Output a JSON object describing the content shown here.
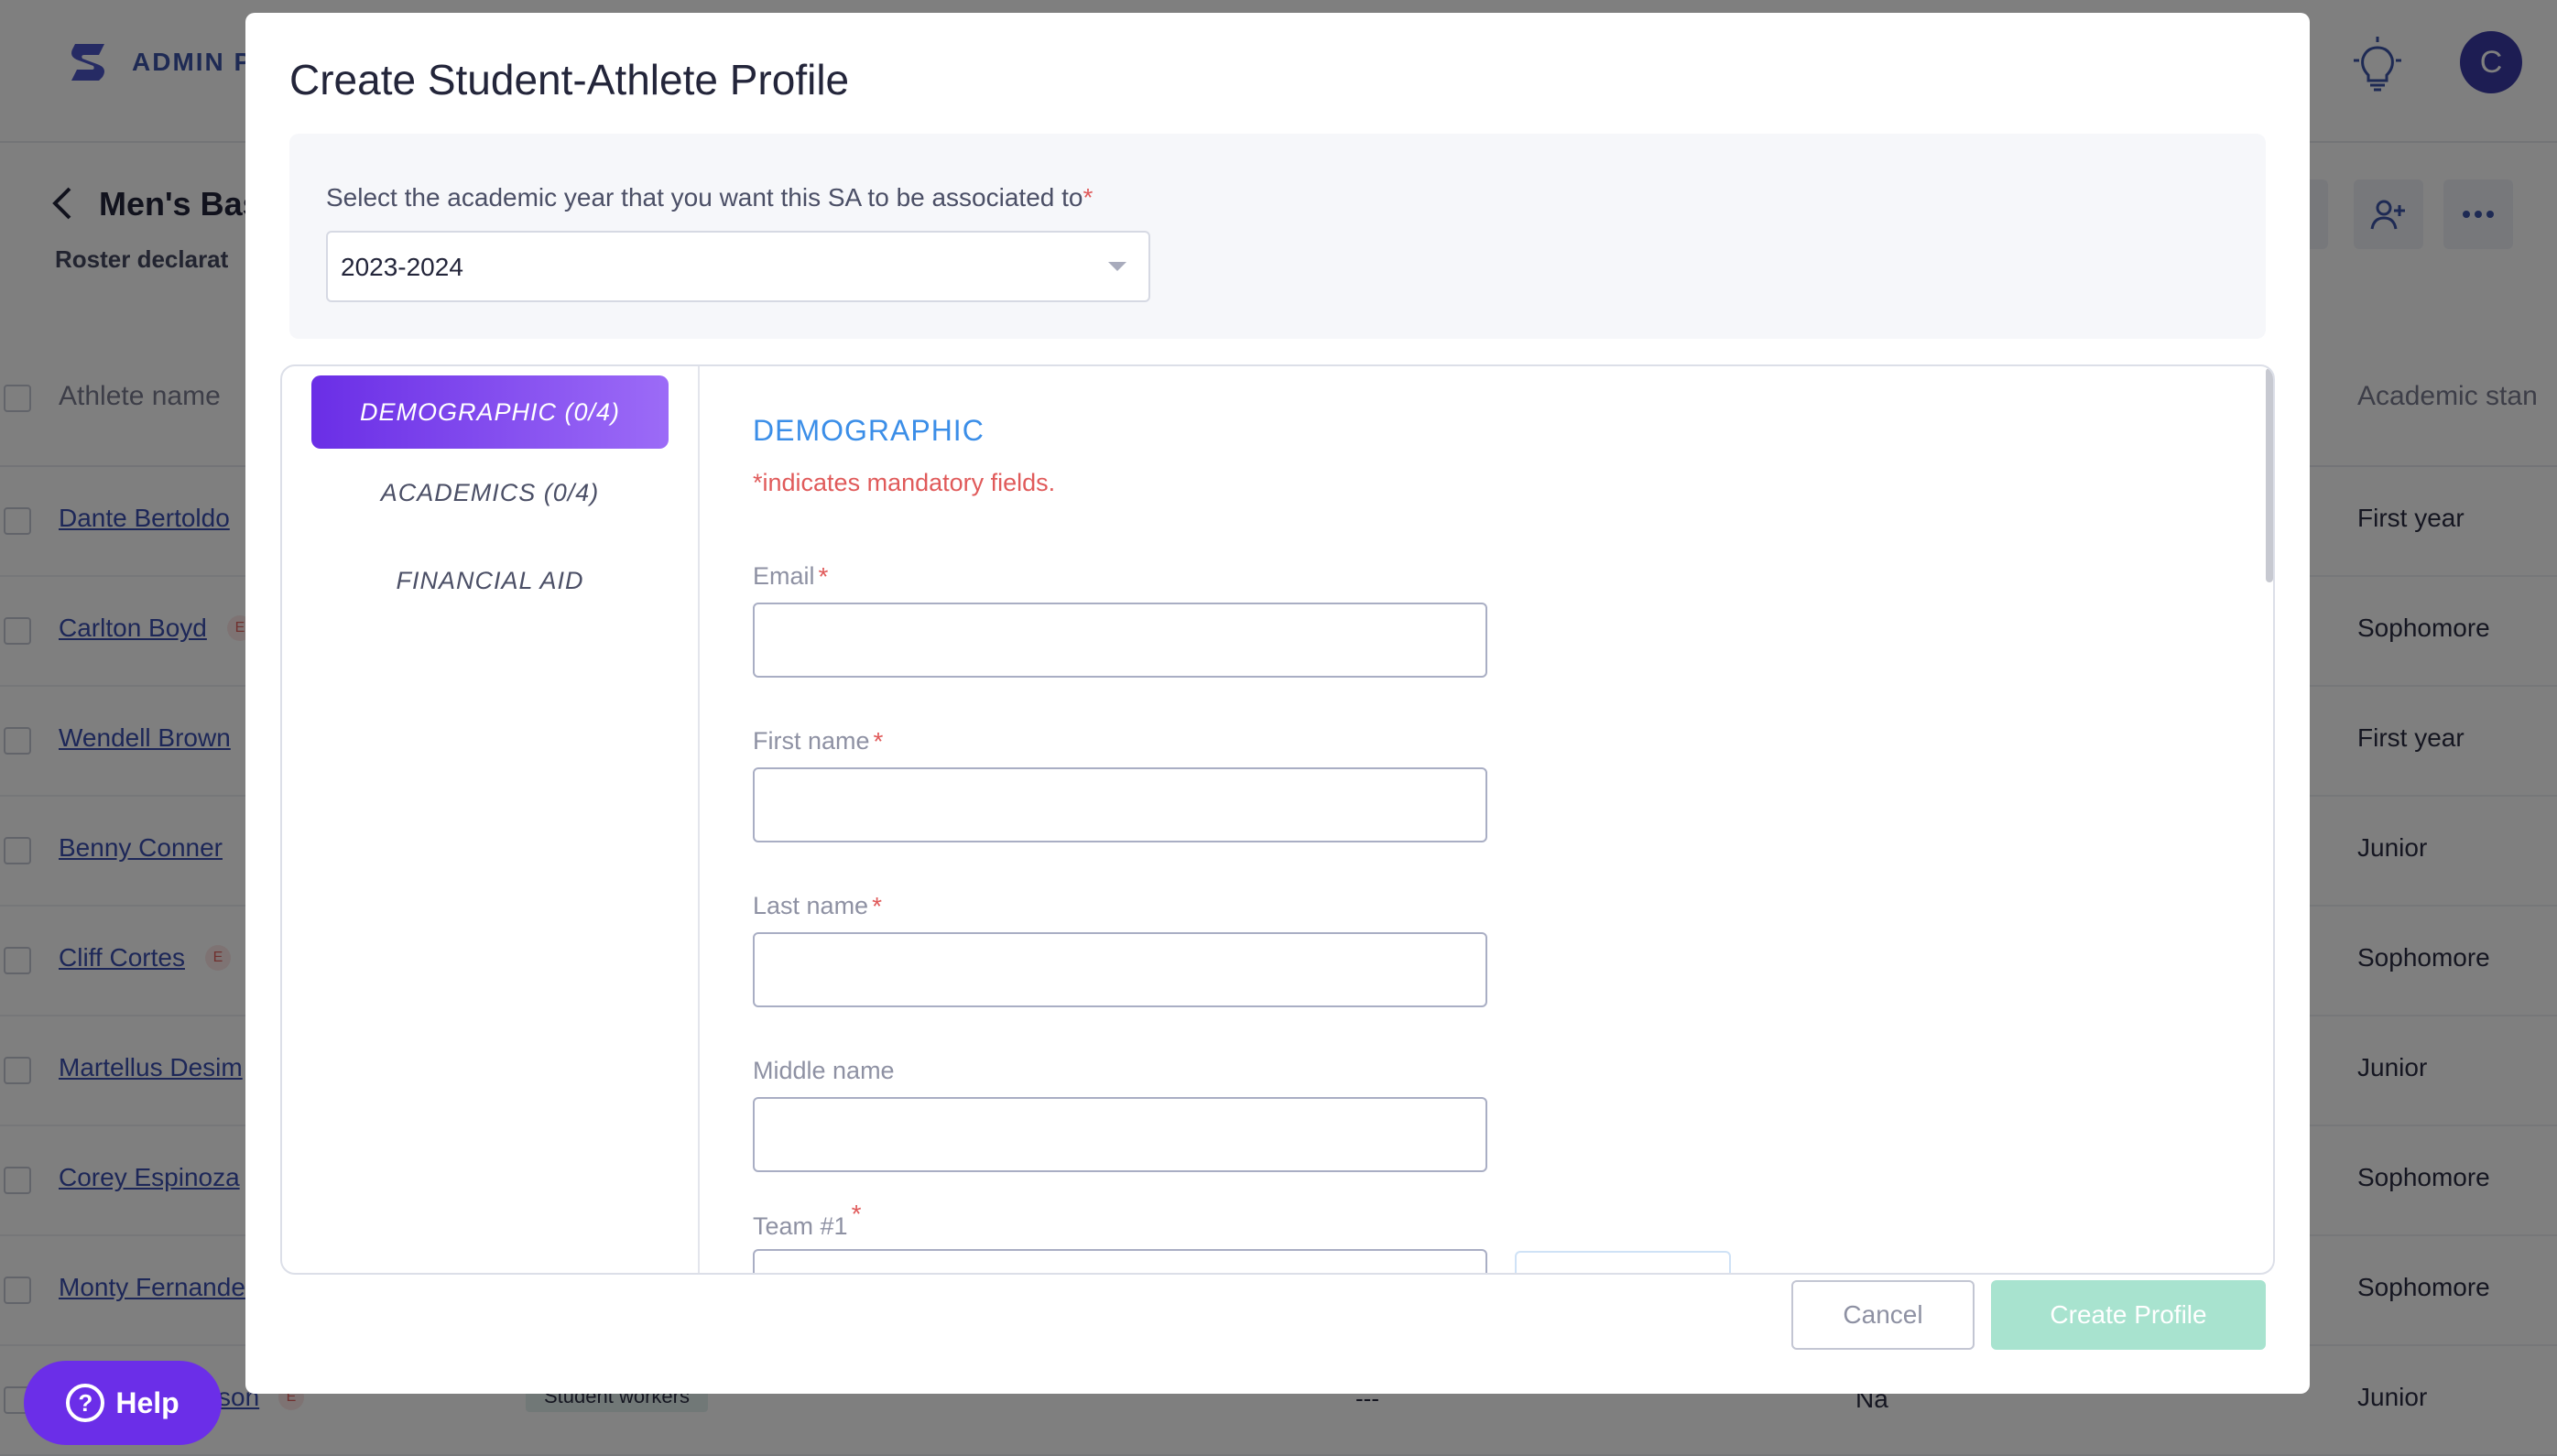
{
  "app": {
    "brand": "ADMIN P",
    "avatar_initial": "C"
  },
  "page": {
    "title": "Men's Bas",
    "subtitle": "Roster declarat"
  },
  "table": {
    "headers": {
      "name": "Athlete name",
      "academic": "Academic stan"
    },
    "rows": [
      {
        "name": "Dante Bertoldo",
        "badge": "",
        "academic": "First year"
      },
      {
        "name": "Carlton Boyd",
        "badge": "E",
        "academic": "Sophomore"
      },
      {
        "name": "Wendell Brown",
        "badge": "",
        "academic": "First year"
      },
      {
        "name": "Benny Conner",
        "badge": "",
        "academic": "Junior"
      },
      {
        "name": "Cliff Cortes",
        "badge": "E",
        "academic": "Sophomore"
      },
      {
        "name": "Martellus Desim",
        "badge": "",
        "academic": "Junior"
      },
      {
        "name": "Corey Espinoza",
        "badge": "",
        "academic": "Sophomore"
      },
      {
        "name": "Monty Fernande",
        "badge": "",
        "academic": "Sophomore"
      },
      {
        "name": "son",
        "badge": "E",
        "academic": "Junior",
        "tag": "Student workers",
        "col3": "---",
        "col4": "Na"
      }
    ]
  },
  "help": {
    "label": "Help",
    "glyph": "?"
  },
  "modal": {
    "title": "Create Student-Athlete Profile",
    "year_label": "Select the academic year that you want this SA to be associated to",
    "required_mark": "*",
    "year_value": "2023-2024",
    "tabs": [
      {
        "label": "DEMOGRAPHIC (0/4)",
        "active": true
      },
      {
        "label": "ACADEMICS (0/4)",
        "active": false
      },
      {
        "label": "FINANCIAL AID",
        "active": false
      }
    ],
    "section_title": "DEMOGRAPHIC",
    "mandatory_note": "*indicates mandatory fields.",
    "fields": {
      "email": {
        "label": "Email",
        "value": "",
        "required": true
      },
      "first_name": {
        "label": "First name",
        "value": "",
        "required": true
      },
      "last_name": {
        "label": "Last name",
        "value": "",
        "required": true
      },
      "middle_name": {
        "label": "Middle name",
        "value": "",
        "required": false
      },
      "team": {
        "label": "Team #1",
        "value": "",
        "required": true
      }
    },
    "cancel_label": "Cancel",
    "create_label": "Create Profile"
  },
  "colors": {
    "accent": "#6b2ee8",
    "section_blue": "#3b8ee8",
    "required_red": "#e05a5a",
    "create_disabled": "#a8e3cf"
  },
  "icons": [
    "brand-logo-icon",
    "lightbulb-icon",
    "back-chevron-icon",
    "edit-icon",
    "add-user-icon",
    "more-icon",
    "caret-down-icon",
    "help-icon"
  ]
}
